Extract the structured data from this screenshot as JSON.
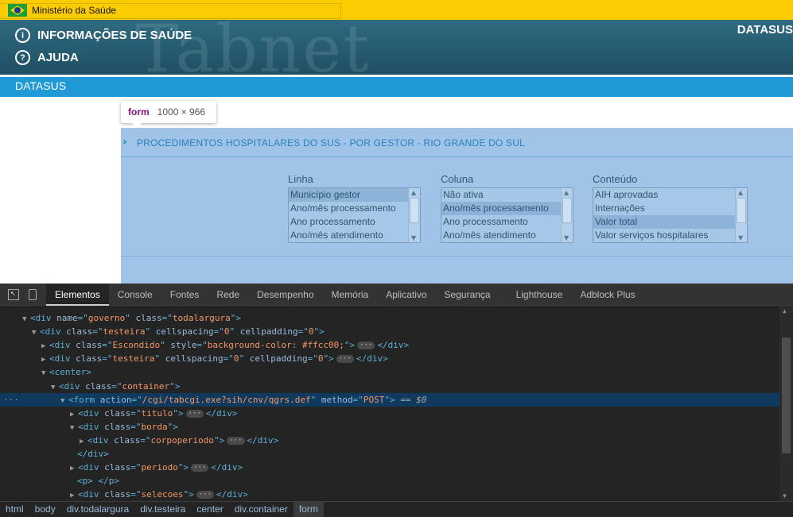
{
  "gov_bar": {
    "text": "Ministério da Saúde",
    "flag_icon": "brazil-flag-icon",
    "color": "#fccc02"
  },
  "header": {
    "watermark": "Tabnet",
    "menu": [
      {
        "label": "INFORMAÇÕES DE SAÚDE",
        "icon": "info-icon",
        "glyph": "i"
      },
      {
        "label": "AJUDA",
        "icon": "help-icon",
        "glyph": "?"
      }
    ],
    "right_label": "DATASUS",
    "bar_label": "DATASUS",
    "bar_color": "#1f9ad6"
  },
  "tooltip": {
    "tag": "form",
    "dimensions": "1000 × 966"
  },
  "form": {
    "title": "PROCEDIMENTOS HOSPITALARES DO SUS - POR GESTOR - RIO GRANDE DO SUL",
    "selects": [
      {
        "label": "Linha",
        "options": [
          "Município gestor",
          "Ano/mês processamento",
          "Ano processamento",
          "Ano/mês atendimento"
        ],
        "selected_index": 0
      },
      {
        "label": "Coluna",
        "options": [
          "Não ativa",
          "Ano/mês processamento",
          "Ano processamento",
          "Ano/mês atendimento"
        ],
        "selected_index": 1
      },
      {
        "label": "Conteúdo",
        "options": [
          "AIH aprovadas",
          "Internações",
          "Valor total",
          "Valor serviços hospitalares"
        ],
        "selected_index": 2
      }
    ]
  },
  "devtools": {
    "tabs": [
      "Elementos",
      "Console",
      "Fontes",
      "Rede",
      "Desempenho",
      "Memória",
      "Aplicativo",
      "Segurança",
      "Lighthouse",
      "Adblock Plus"
    ],
    "active_tab": "Elementos",
    "selected_suffix": "== $0",
    "breadcrumbs": [
      "html",
      "body",
      "div.todalargura",
      "div.testeira",
      "center",
      "div.container",
      "form"
    ],
    "active_breadcrumb": "form"
  }
}
